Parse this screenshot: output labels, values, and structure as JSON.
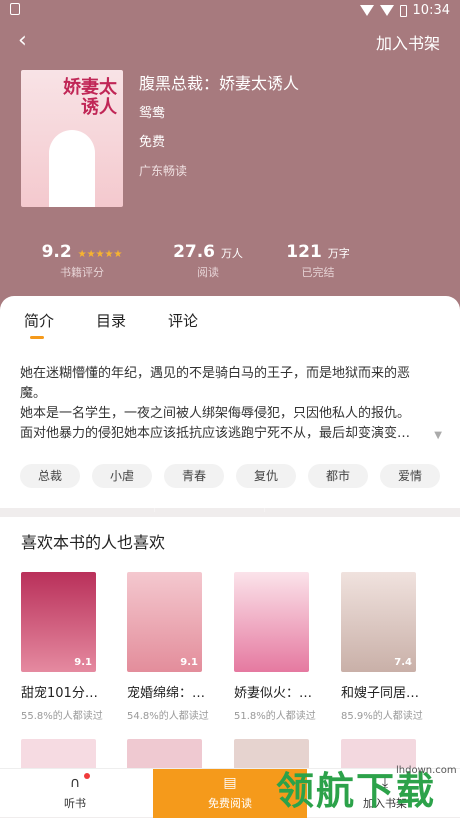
{
  "status": {
    "time": "10:34"
  },
  "topbar": {
    "add_shelf": "加入书架"
  },
  "book": {
    "cover_title": "娇妻太诱人",
    "title": "腹黑总裁：娇妻太诱人",
    "author": "鸳鸯",
    "price": "免费",
    "source": "广东畅读"
  },
  "stats": [
    {
      "num": "9.2",
      "unit": "",
      "label": "书籍评分",
      "stars": "★★★★★"
    },
    {
      "num": "27.6",
      "unit": "万人",
      "label": "阅读"
    },
    {
      "num": "121",
      "unit": "万字",
      "label": "已完结"
    }
  ],
  "tabs": [
    "简介",
    "目录",
    "评论"
  ],
  "intro": "她在迷糊懵懂的年纪，遇见的不是骑白马的王子，而是地狱而来的恶魔。\n她本是一名学生，一夜之间被人绑架侮辱侵犯，只因他私人的报仇。\n面对他暴力的侵犯她本应该抵抗应该逃跑宁死不从，最后却变演变…",
  "tags": [
    "总裁",
    "小虐",
    "青春",
    "复仇",
    "都市",
    "爱情"
  ],
  "recommend": {
    "heading": "喜欢本书的人也喜欢",
    "books": [
      {
        "name": "甜宠101分…",
        "pct": "55.8%的人都读过",
        "score": "9.1",
        "color": "#c84a6a"
      },
      {
        "name": "宠婚绵绵：…",
        "pct": "54.8%的人都读过",
        "score": "9.1",
        "color": "#e9b1b7"
      },
      {
        "name": "娇妻似火：…",
        "pct": "51.8%的人都读过",
        "score": "",
        "color": "#f3d6dc"
      },
      {
        "name": "和嫂子同居…",
        "pct": "85.9%的人都读过",
        "score": "7.4",
        "color": "#d9c7c2"
      }
    ]
  },
  "bottom": {
    "listen": "听书",
    "read": "免费阅读",
    "add": "加入书架"
  },
  "watermark": {
    "text": "领航下载",
    "url": "lhdown.com"
  }
}
